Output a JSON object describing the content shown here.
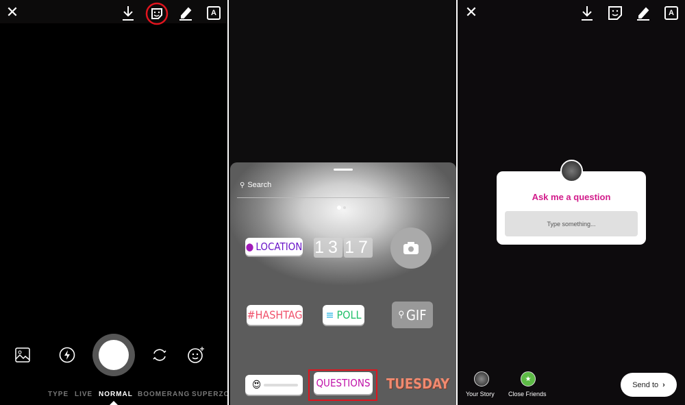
{
  "panel1": {
    "icons": [
      "close-icon",
      "download-icon",
      "sticker-icon",
      "draw-icon",
      "text-icon",
      "gallery-icon",
      "flash-icon",
      "shutter-button",
      "flip-camera-icon",
      "face-effects-icon"
    ],
    "modes": [
      "TYPE",
      "LIVE",
      "NORMAL",
      "BOOMERANG",
      "SUPERZOOM"
    ],
    "active_mode": "NORMAL",
    "highlight_color": "#e0141e"
  },
  "panel2": {
    "search_placeholder": "Search",
    "stickers": {
      "location": "LOCATION",
      "time_h": "13",
      "time_m": "17",
      "hashtag": "#HASHTAG",
      "poll": "POLL",
      "gif": "GIF",
      "questions": "QUESTIONS",
      "day": "TUESDAY",
      "slider_emoji": "😍"
    }
  },
  "panel3": {
    "question_title": "Ask me a question",
    "question_placeholder": "Type something...",
    "your_story": "Your Story",
    "close_friends": "Close Friends",
    "send_to": "Send to",
    "close_friends_color": "#5dbb46"
  }
}
